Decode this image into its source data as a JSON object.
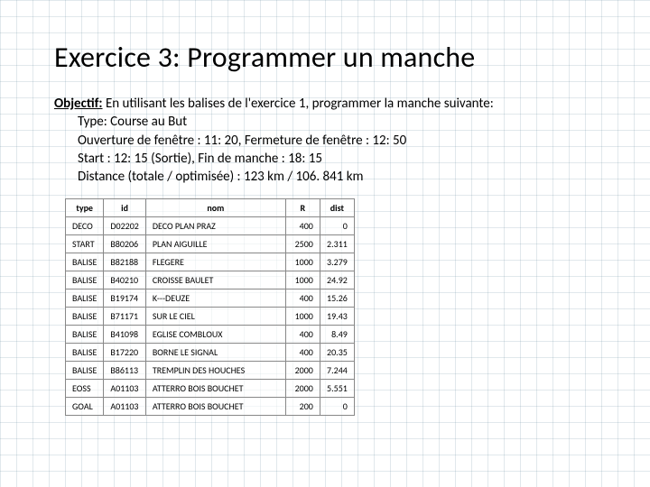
{
  "title": "Exercice 3: Programmer un manche",
  "objective": {
    "label": "Objectif:",
    "first": "En utilisant les balises de l'exercice 1, programmer la manche suivante:",
    "lines": [
      "Type: Course au But",
      "Ouverture de fenêtre : 11: 20, Fermeture de fenêtre : 12: 50",
      "Start : 12: 15 (Sortie), Fin de manche : 18: 15",
      "Distance (totale / optimisée) : 123 km / 106. 841 km"
    ]
  },
  "table": {
    "headers": {
      "c0": "type",
      "c1": "id",
      "c2": "nom",
      "c3": "R",
      "c4": "dist"
    },
    "rows": [
      {
        "type": "DECO",
        "id": "D02202",
        "nom": "DECO PLAN PRAZ",
        "r": "400",
        "dist": "0"
      },
      {
        "type": "START",
        "id": "B80206",
        "nom": "PLAN AIGUILLE",
        "r": "2500",
        "dist": "2.311"
      },
      {
        "type": "BALISE",
        "id": "B82188",
        "nom": "FLEGERE",
        "r": "1000",
        "dist": "3.279"
      },
      {
        "type": "BALISE",
        "id": "B40210",
        "nom": "CROISSE BAULET",
        "r": "1000",
        "dist": "24.92"
      },
      {
        "type": "BALISE",
        "id": "B19174",
        "nom": "K---DEUZE",
        "r": "400",
        "dist": "15.26"
      },
      {
        "type": "BALISE",
        "id": "B71171",
        "nom": "SUR LE CIEL",
        "r": "1000",
        "dist": "19.43"
      },
      {
        "type": "BALISE",
        "id": "B41098",
        "nom": "EGLISE COMBLOUX",
        "r": "400",
        "dist": "8.49"
      },
      {
        "type": "BALISE",
        "id": "B17220",
        "nom": "BORNE LE SIGNAL",
        "r": "400",
        "dist": "20.35"
      },
      {
        "type": "BALISE",
        "id": "B86113",
        "nom": "TREMPLIN DES HOUCHES",
        "r": "2000",
        "dist": "7.244"
      },
      {
        "type": "EOSS",
        "id": "A01103",
        "nom": "ATTERRO BOIS BOUCHET",
        "r": "2000",
        "dist": "5.551"
      },
      {
        "type": "GOAL",
        "id": "A01103",
        "nom": "ATTERRO BOIS BOUCHET",
        "r": "200",
        "dist": "0"
      }
    ]
  }
}
